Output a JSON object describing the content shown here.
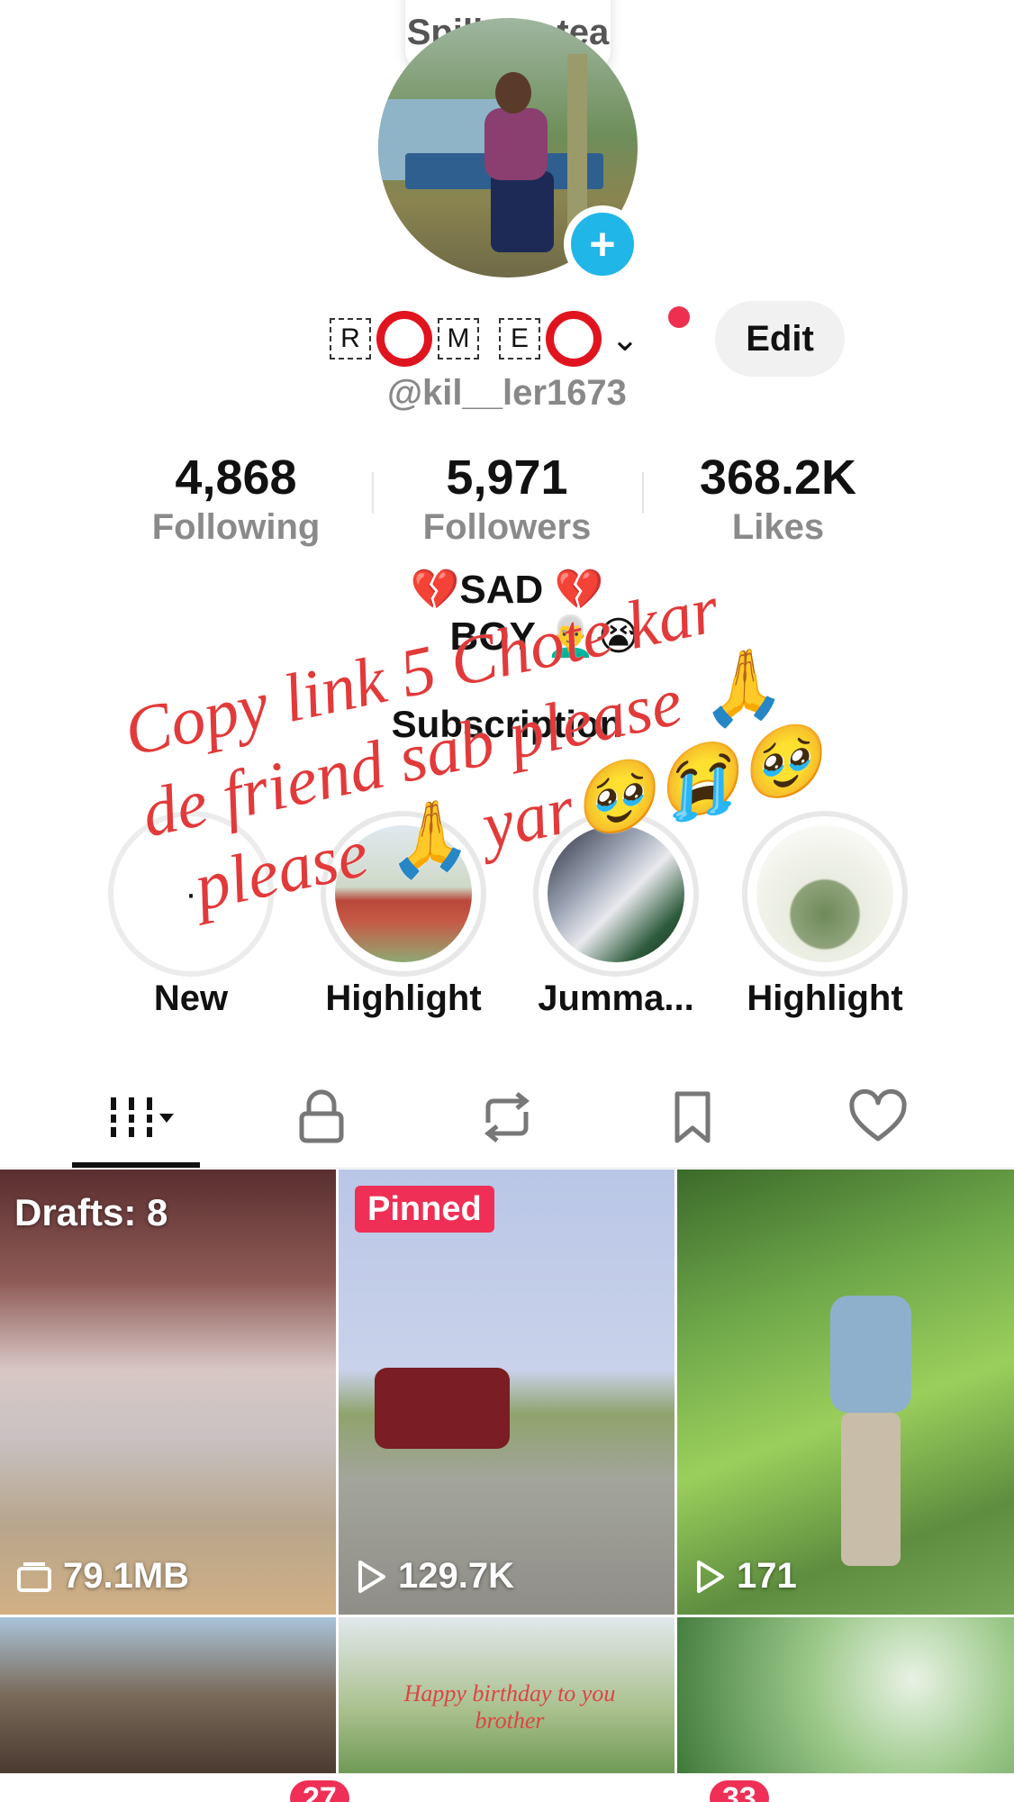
{
  "bubble": {
    "text": "Spill the tea"
  },
  "profile": {
    "name_parts": [
      "R",
      "M",
      "E"
    ],
    "handle": "@kil__ler1673",
    "edit_label": "Edit",
    "add_symbol": "+"
  },
  "stats": [
    {
      "value": "4,868",
      "label": "Following"
    },
    {
      "value": "5,971",
      "label": "Followers"
    },
    {
      "value": "368.2K",
      "label": "Likes"
    }
  ],
  "bio": {
    "line1": "💔SAD 💔",
    "line2": "BOY 👨‍🦳😭",
    "subscription": "Subscription"
  },
  "highlights": [
    {
      "label": "New"
    },
    {
      "label": "Highlight"
    },
    {
      "label": "Jumma..."
    },
    {
      "label": "Highlight"
    }
  ],
  "overlay_text": {
    "line1": "Copy link 5 Chote kar",
    "line2": "de friend sab please 🙏",
    "line3": "please 🙏 yar🥹😭🥹"
  },
  "tabs": [
    {
      "name": "videos-grid",
      "icon": "grid-icon"
    },
    {
      "name": "private",
      "icon": "lock-icon"
    },
    {
      "name": "reposts",
      "icon": "repost-icon"
    },
    {
      "name": "favorites",
      "icon": "bookmark-icon"
    },
    {
      "name": "liked",
      "icon": "heart-icon"
    }
  ],
  "grid": [
    {
      "badge": "Drafts: 8",
      "count": "79.1MB",
      "count_icon": "drafts-icon"
    },
    {
      "badge": "Pinned",
      "count": "129.7K",
      "count_icon": "play-icon"
    },
    {
      "badge": "",
      "count": "171",
      "count_icon": "play-icon"
    },
    {
      "badge": "",
      "count": ""
    },
    {
      "badge": "",
      "count": "",
      "caption": "Happy birthday to you brother"
    },
    {
      "badge": "",
      "count": ""
    }
  ],
  "nav_badges": [
    "27",
    "33"
  ],
  "colors": {
    "accent": "#20b6e8",
    "pinned": "#ef2f55",
    "overlay": "#e23a3a",
    "ring": "#e0141f"
  }
}
